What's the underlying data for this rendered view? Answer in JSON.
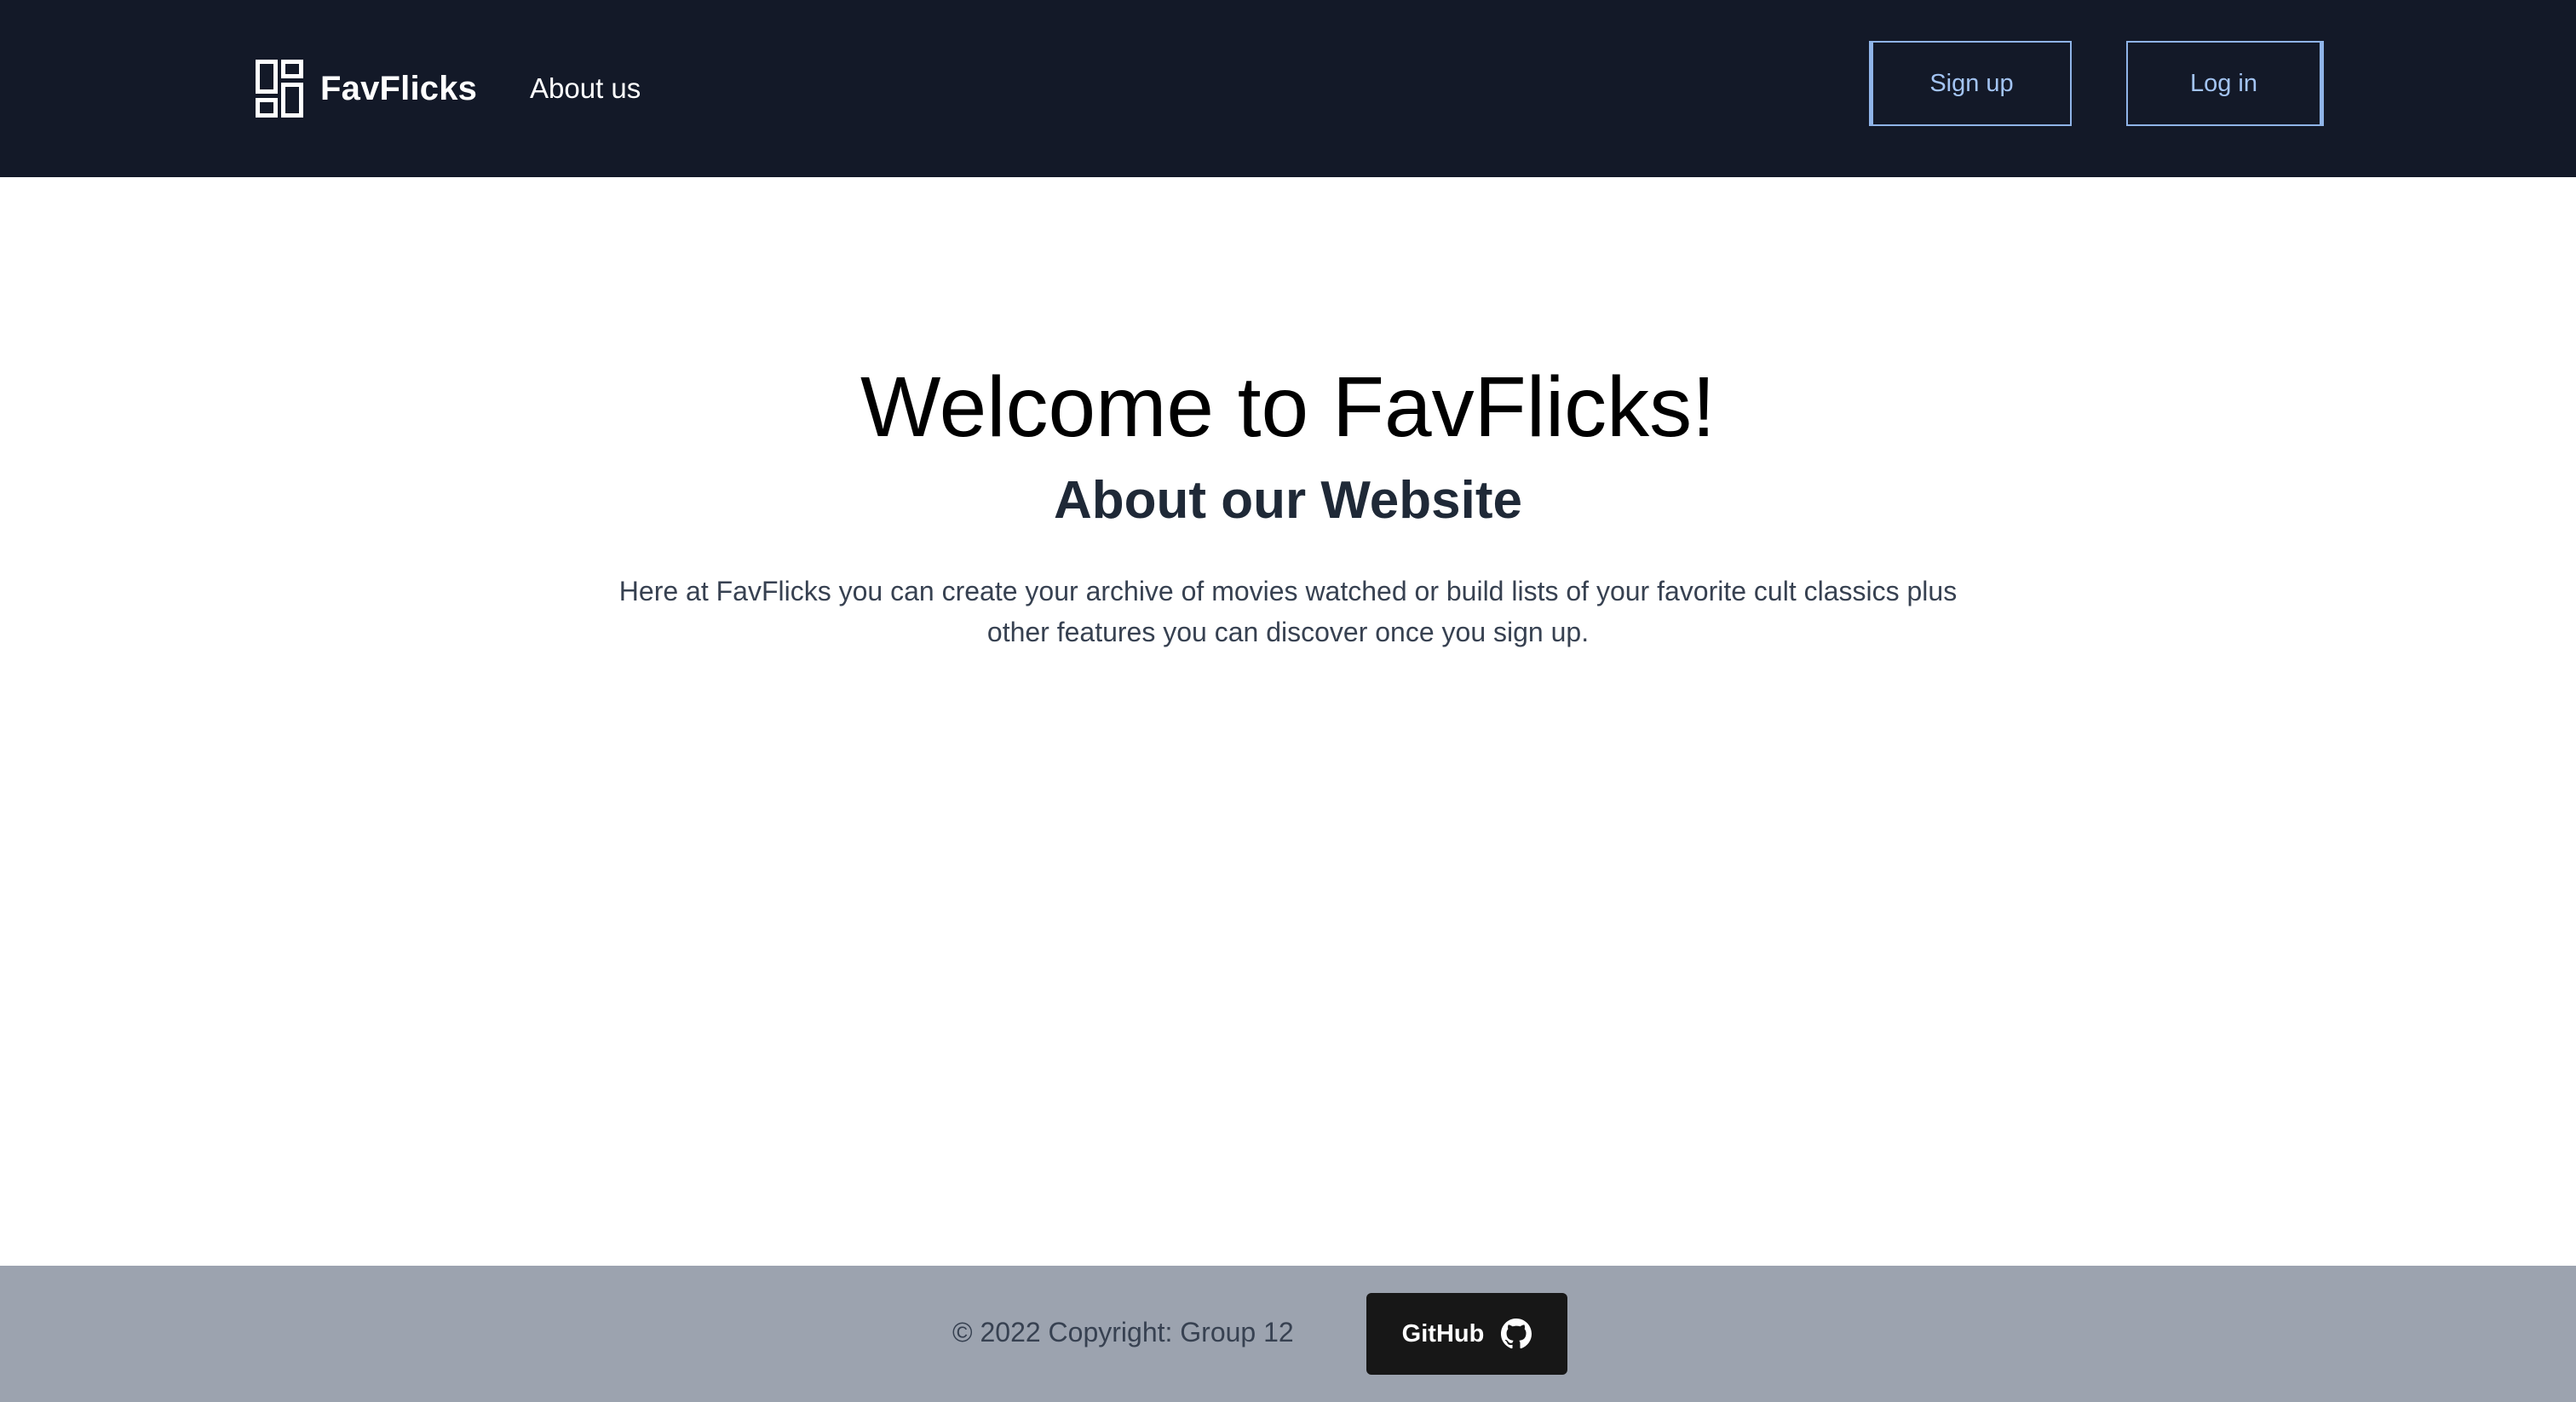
{
  "header": {
    "brand_name": "FavFlicks",
    "brand_icon": "dashboard-icon",
    "nav_about": "About us",
    "signup_label": "Sign up",
    "login_label": "Log in"
  },
  "main": {
    "title": "Welcome to FavFlicks!",
    "subtitle": "About our Website",
    "body": "Here at FavFlicks you can create your archive of movies watched or build lists of your favorite cult classics plus other features you can discover once you sign up."
  },
  "footer": {
    "copyright": "© 2022 Copyright: Group 12",
    "github_label": "GitHub",
    "github_icon": "github-icon"
  },
  "colors": {
    "navbar_bg": "#131928",
    "button_outline": "#8fb4e8",
    "footer_bg": "#9ca3af",
    "github_button_bg": "#171717"
  }
}
